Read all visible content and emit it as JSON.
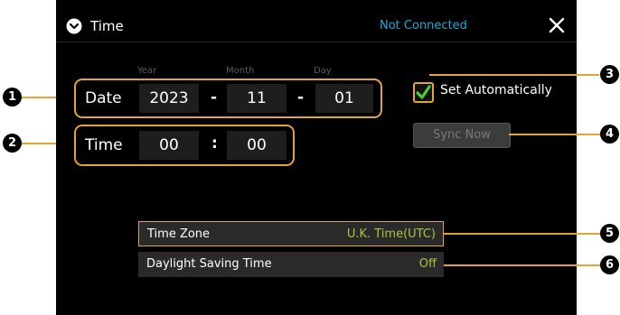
{
  "header": {
    "title": "Time",
    "status": "Not Connected"
  },
  "columns": {
    "year": "Year",
    "month": "Month",
    "day": "Day"
  },
  "date": {
    "label": "Date",
    "year": "2023",
    "month": "11",
    "day": "01",
    "separator": "-"
  },
  "time": {
    "label": "Time",
    "hour": "00",
    "minute": "00",
    "separator": ":"
  },
  "set_automatically": {
    "label": "Set Automatically",
    "checked": true
  },
  "sync_now": {
    "label": "Sync Now",
    "enabled": false
  },
  "settings": [
    {
      "label": "Time Zone",
      "value": "U.K. Time(UTC)"
    },
    {
      "label": "Daylight Saving Time",
      "value": "Off"
    }
  ],
  "callouts": [
    "1",
    "2",
    "3",
    "4",
    "5",
    "6"
  ],
  "colors": {
    "accent": "#e3a531",
    "status": "#1aa9d6",
    "value": "#a8c63a",
    "checkmark": "#4fc935"
  }
}
